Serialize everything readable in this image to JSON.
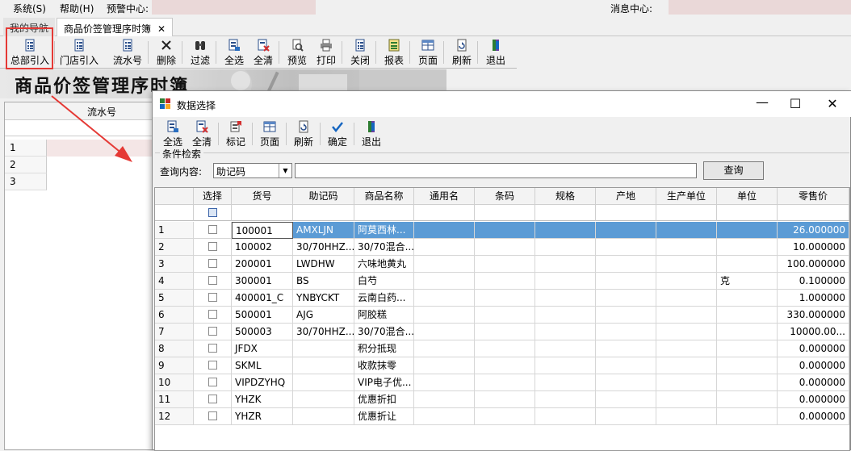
{
  "menu": {
    "items": [
      "系统(S)",
      "帮助(H)",
      "预警中心:"
    ],
    "message_center": "消息中心:"
  },
  "tabs": [
    {
      "label": "我的导航",
      "active": false
    },
    {
      "label": "商品价签管理序时簿",
      "active": true
    }
  ],
  "main_toolbar": [
    {
      "label": "总部引入",
      "icon": "list-icon"
    },
    {
      "label": "门店引入",
      "icon": "list-icon"
    },
    {
      "label": "流水号",
      "icon": "list-icon"
    },
    {
      "label": "删除",
      "icon": "x-icon"
    },
    {
      "label": "过滤",
      "icon": "binoculars-icon"
    },
    {
      "label": "全选",
      "icon": "select-all-icon"
    },
    {
      "label": "全清",
      "icon": "clear-all-icon"
    },
    {
      "label": "预览",
      "icon": "preview-icon"
    },
    {
      "label": "打印",
      "icon": "printer-icon"
    },
    {
      "label": "关闭",
      "icon": "list-icon"
    },
    {
      "label": "报表",
      "icon": "report-icon"
    },
    {
      "label": "页面",
      "icon": "page-icon"
    },
    {
      "label": "刷新",
      "icon": "refresh-icon"
    },
    {
      "label": "退出",
      "icon": "exit-icon"
    }
  ],
  "banner_title": "商品价签管理序时簿",
  "background_grid": {
    "column": "流水号",
    "rows": [
      "1",
      "2",
      "3"
    ]
  },
  "dialog": {
    "title": "数据选择",
    "toolbar": [
      {
        "label": "全选",
        "icon": "select-all-icon"
      },
      {
        "label": "全清",
        "icon": "clear-all-icon"
      },
      {
        "label": "标记",
        "icon": "mark-icon"
      },
      {
        "label": "页面",
        "icon": "page-icon"
      },
      {
        "label": "刷新",
        "icon": "refresh-icon"
      },
      {
        "label": "确定",
        "icon": "check-icon"
      },
      {
        "label": "退出",
        "icon": "exit-icon"
      }
    ],
    "criteria_legend": "条件检索",
    "query_label": "查询内容:",
    "query_field_selected": "助记码",
    "query_value": "",
    "query_button": "查询",
    "columns": [
      "选择",
      "货号",
      "助记码",
      "商品名称",
      "通用名",
      "条码",
      "规格",
      "产地",
      "生产单位",
      "单位",
      "零售价"
    ],
    "rows": [
      {
        "n": "1",
        "code": "100001",
        "mnemonic": "AMXLJN",
        "name": "阿莫西林...",
        "unit": "",
        "price": "26.000000",
        "selected": true
      },
      {
        "n": "2",
        "code": "100002",
        "mnemonic": "30/70HHZ...",
        "name": "30/70混合...",
        "unit": "",
        "price": "10.000000",
        "selected": false
      },
      {
        "n": "3",
        "code": "200001",
        "mnemonic": "LWDHW",
        "name": "六味地黄丸",
        "unit": "",
        "price": "100.000000",
        "selected": false
      },
      {
        "n": "4",
        "code": "300001",
        "mnemonic": "BS",
        "name": "白芍",
        "unit": "克",
        "price": "0.100000",
        "selected": false
      },
      {
        "n": "5",
        "code": "400001_C",
        "mnemonic": "YNBYCKT",
        "name": "云南白药...",
        "unit": "",
        "price": "1.000000",
        "selected": false
      },
      {
        "n": "6",
        "code": "500001",
        "mnemonic": "AJG",
        "name": "阿胶糕",
        "unit": "",
        "price": "330.000000",
        "selected": false
      },
      {
        "n": "7",
        "code": "500003",
        "mnemonic": "30/70HHZ...",
        "name": "30/70混合...",
        "unit": "",
        "price": "10000.00...",
        "selected": false
      },
      {
        "n": "8",
        "code": "JFDX",
        "mnemonic": "",
        "name": "积分抵现",
        "unit": "",
        "price": "0.000000",
        "selected": false
      },
      {
        "n": "9",
        "code": "SKML",
        "mnemonic": "",
        "name": "收款抹零",
        "unit": "",
        "price": "0.000000",
        "selected": false
      },
      {
        "n": "10",
        "code": "VIPDZYHQ",
        "mnemonic": "",
        "name": "VIP电子优...",
        "unit": "",
        "price": "0.000000",
        "selected": false
      },
      {
        "n": "11",
        "code": "YHZK",
        "mnemonic": "",
        "name": "优惠折扣",
        "unit": "",
        "price": "0.000000",
        "selected": false
      },
      {
        "n": "12",
        "code": "YHZR",
        "mnemonic": "",
        "name": "优惠折让",
        "unit": "",
        "price": "0.000000",
        "selected": false
      }
    ]
  },
  "colors": {
    "highlight_red": "#e53935",
    "selection_blue": "#5b9bd5"
  }
}
